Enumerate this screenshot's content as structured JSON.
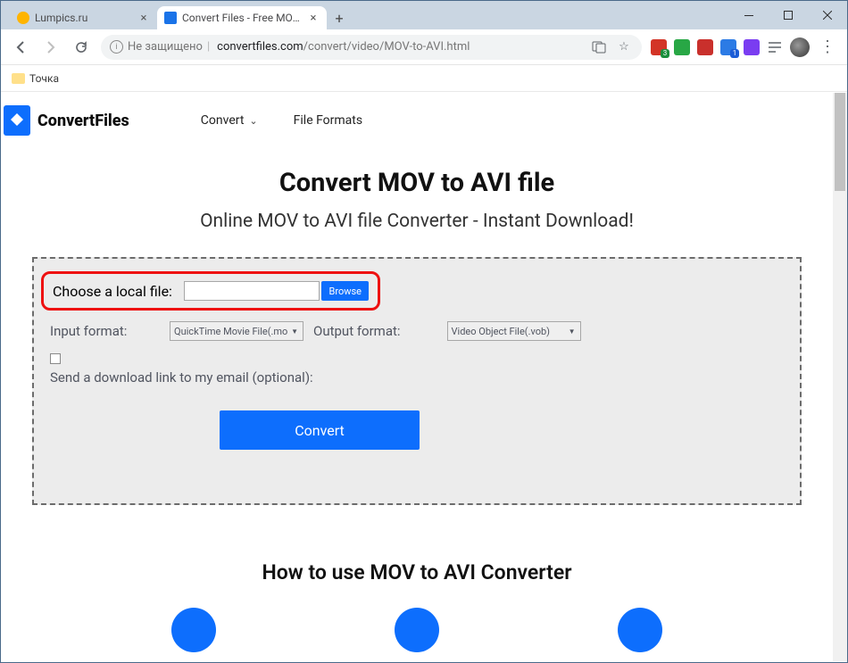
{
  "window": {
    "tabs": [
      {
        "title": "Lumpics.ru"
      },
      {
        "title": "Convert Files - Free MOV to AVI c"
      }
    ]
  },
  "toolbar": {
    "securityText": "Не защищено",
    "urlDomain": "convertfiles.com",
    "urlPath": "/convert/video/MOV-to-AVI.html",
    "extBadges": {
      "b1": "3",
      "b2": "1"
    }
  },
  "bookmarks": {
    "item1": "Точка"
  },
  "site": {
    "brand": "ConvertFiles",
    "nav": {
      "convert": "Convert",
      "formats": "File Formats"
    }
  },
  "page": {
    "h1": "Convert MOV to AVI file",
    "subheading": "Online MOV to AVI file Converter - Instant Download!",
    "chooseFileLabel": "Choose a local file:",
    "browse": "Browse",
    "inputFormatLabel": "Input format:",
    "inputFormatValue": "QuickTime Movie File(.mo",
    "outputFormatLabel": "Output format:",
    "outputFormatValue": "Video Object File(.vob)",
    "emailLabel": "Send a download link to my email (optional):",
    "convertBtn": "Convert",
    "howToHeading": "How to use MOV to AVI Converter"
  }
}
